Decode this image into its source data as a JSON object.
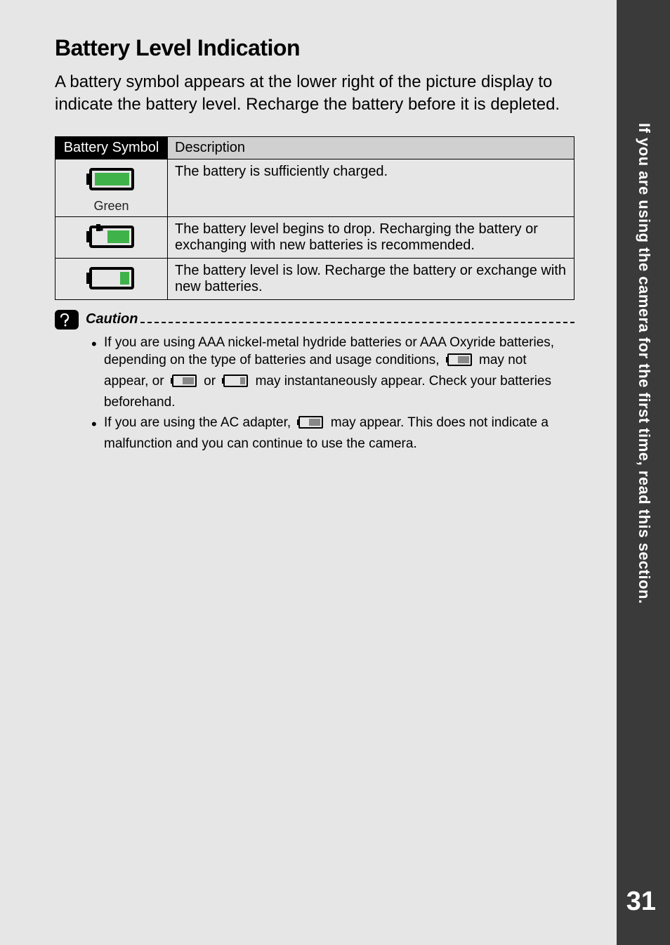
{
  "heading": "Battery Level Indication",
  "intro": "A battery symbol appears at the lower right of the picture display to indicate the battery level. Recharge the battery before it is depleted.",
  "table": {
    "col1_header": "Battery Symbol",
    "col2_header": "Description",
    "rows": [
      {
        "symbol_label": "Green",
        "desc": "The battery is sufficiently charged."
      },
      {
        "symbol_label": "",
        "desc": "The battery level begins to drop. Recharging the battery or exchanging with new batteries is recommended."
      },
      {
        "symbol_label": "",
        "desc": "The battery level is low. Recharge the battery or exchange with new batteries."
      }
    ]
  },
  "caution": {
    "label": "Caution",
    "bullets": [
      {
        "pre": "If you are using AAA nickel-metal hydride batteries or AAA Oxyride batteries, depending on the type of batteries and usage conditions, ",
        "mid1": " may not appear, or ",
        "mid2": " or ",
        "mid3": " may instantaneously appear. Check your batteries beforehand."
      },
      {
        "pre": "If you are using the AC adapter, ",
        "post": " may appear. This does not indicate a malfunction and you can continue to use the camera."
      }
    ]
  },
  "side_text": "If you are using the camera for the first time, read this section.",
  "page_number": "31",
  "icons": {
    "battery_full": "battery-full-icon",
    "battery_mid": "battery-mid-icon",
    "battery_low": "battery-low-icon",
    "battery_inline_mid": "battery-inline-mid-icon",
    "battery_inline_low": "battery-inline-low-icon",
    "caution": "caution-icon"
  }
}
